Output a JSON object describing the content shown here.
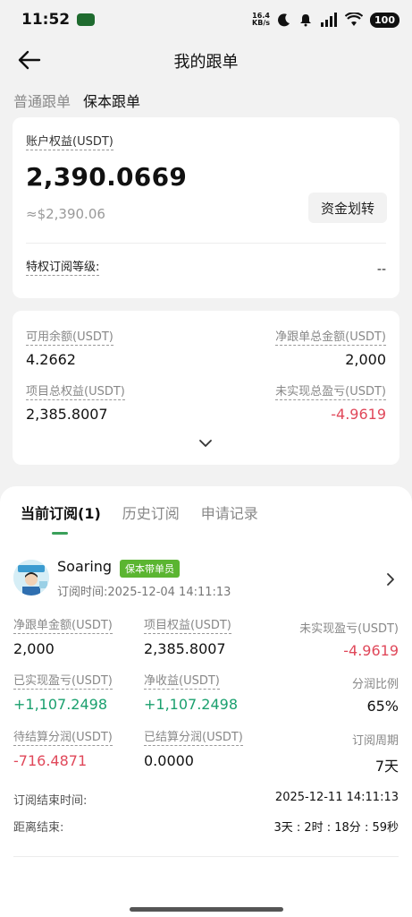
{
  "status_bar": {
    "time": "11:52",
    "net_speed_value": "16.4",
    "net_speed_unit": "KB/s",
    "battery": "100"
  },
  "nav": {
    "title": "我的跟单"
  },
  "top_tabs": [
    {
      "label": "普通跟单",
      "active": false
    },
    {
      "label": "保本跟单",
      "active": true
    }
  ],
  "account": {
    "equity_label": "账户权益(USDT)",
    "equity_value": "2,390.0669",
    "equity_approx": "≈$2,390.06",
    "transfer_button": "资金划转",
    "tier_label": "特权订阅等级:",
    "tier_value": "--"
  },
  "stats": {
    "available_label": "可用余额(USDT)",
    "available_value": "4.2662",
    "net_follow_total_label": "净跟单总金额(USDT)",
    "net_follow_total_value": "2,000",
    "project_equity_label": "项目总权益(USDT)",
    "project_equity_value": "2,385.8007",
    "unrealized_total_label": "未实现总盈亏(USDT)",
    "unrealized_total_value": "-4.9619"
  },
  "sub_tabs": [
    {
      "label": "当前订阅(1)",
      "active": true
    },
    {
      "label": "历史订阅",
      "active": false
    },
    {
      "label": "申请记录",
      "active": false
    }
  ],
  "subscription": {
    "trader_name": "Soaring",
    "badge": "保本带单员",
    "sub_time": "订阅时间:2025-12-04 14:11:13",
    "net_follow_label": "净跟单金额(USDT)",
    "net_follow_value": "2,000",
    "project_equity_label": "项目权益(USDT)",
    "project_equity_value": "2,385.8007",
    "unrealized_label": "未实现盈亏(USDT)",
    "unrealized_value": "-4.9619",
    "realized_label": "已实现盈亏(USDT)",
    "realized_value": "+1,107.2498",
    "net_profit_label": "净收益(USDT)",
    "net_profit_value": "+1,107.2498",
    "share_ratio_label": "分润比例",
    "share_ratio_value": "65%",
    "pending_share_label": "待结算分润(USDT)",
    "pending_share_value": "-716.4871",
    "settled_share_label": "已结算分润(USDT)",
    "settled_share_value": "0.0000",
    "period_label": "订阅周期",
    "period_value": "7天",
    "end_time_label": "订阅结束时间:",
    "end_time_value": "2025-12-11 14:11:13",
    "remaining_label": "距离结束:",
    "remaining_value": "3天 : 2时 : 18分 : 59秒"
  },
  "colors": {
    "negative": "#e0485a",
    "positive": "#1aa06e",
    "accent_green": "#3aa05a",
    "badge_green": "#5bb531"
  }
}
